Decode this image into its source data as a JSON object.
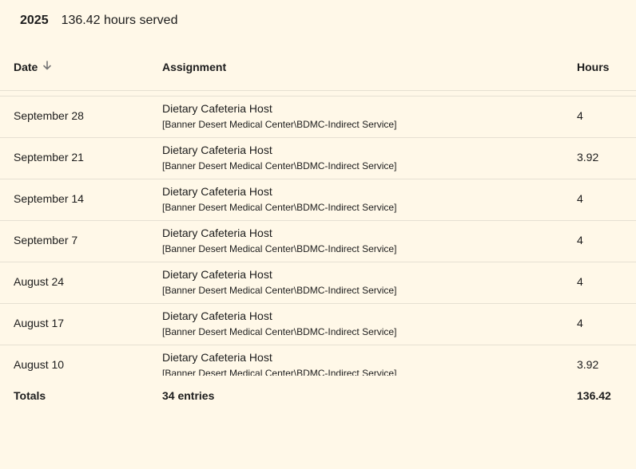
{
  "summary": {
    "year": "2025",
    "hours_served": "136.42 hours served"
  },
  "table": {
    "columns": {
      "date": "Date",
      "assignment": "Assignment",
      "hours": "Hours"
    },
    "sort_icon": "arrow-down-icon",
    "rows": [
      {
        "date": "September 28",
        "title": "Dietary Cafeteria Host",
        "location": "[Banner Desert Medical Center\\BDMC-Indirect Service]",
        "hours": "4"
      },
      {
        "date": "September 21",
        "title": "Dietary Cafeteria Host",
        "location": "[Banner Desert Medical Center\\BDMC-Indirect Service]",
        "hours": "3.92"
      },
      {
        "date": "September 14",
        "title": "Dietary Cafeteria Host",
        "location": "[Banner Desert Medical Center\\BDMC-Indirect Service]",
        "hours": "4"
      },
      {
        "date": "September 7",
        "title": "Dietary Cafeteria Host",
        "location": "[Banner Desert Medical Center\\BDMC-Indirect Service]",
        "hours": "4"
      },
      {
        "date": "August 24",
        "title": "Dietary Cafeteria Host",
        "location": "[Banner Desert Medical Center\\BDMC-Indirect Service]",
        "hours": "4"
      },
      {
        "date": "August 17",
        "title": "Dietary Cafeteria Host",
        "location": "[Banner Desert Medical Center\\BDMC-Indirect Service]",
        "hours": "4"
      },
      {
        "date": "August 10",
        "title": "Dietary Cafeteria Host",
        "location": "[Banner Desert Medical Center\\BDMC-Indirect Service]",
        "hours": "3.92"
      }
    ],
    "totals": {
      "label": "Totals",
      "entries": "34 entries",
      "hours": "136.42"
    }
  },
  "colors": {
    "background": "#fff8e8",
    "text": "#1c1c1c",
    "divider": "#e6e0d2",
    "sort_icon": "#757575"
  }
}
